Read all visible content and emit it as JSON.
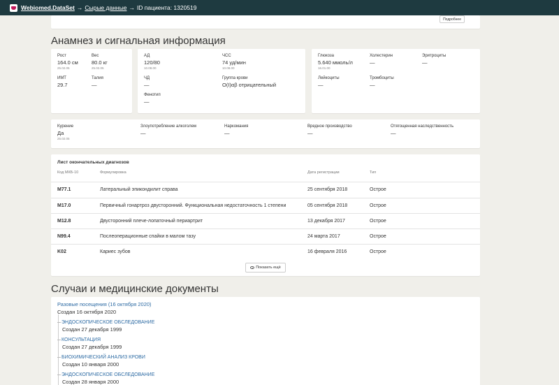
{
  "header": {
    "brand": "Webiomed.DataSet",
    "arrow": "→",
    "crumb": "Сырые данные",
    "patient_id": "ID пациента: 1320519"
  },
  "top_panel": {
    "details_button": "Подробнее"
  },
  "anamnesis": {
    "title": "Анамнез и сигнальная информация",
    "body": {
      "height": {
        "label": "Рост",
        "value": "164.0 см",
        "date": "25.02.05"
      },
      "weight": {
        "label": "Вес",
        "value": "80.0 кг",
        "date": "25.02.05"
      },
      "bmi": {
        "label": "ИМТ",
        "value": "29.7"
      },
      "waist": {
        "label": "Талия",
        "value": "—"
      }
    },
    "vitals": {
      "bp": {
        "label": "АД",
        "value": "120/80",
        "date": "10.08.00"
      },
      "hr": {
        "label": "ЧСС",
        "value": "74 уд/мин",
        "date": "10.08.00"
      },
      "rr": {
        "label": "ЧД",
        "value": "—"
      },
      "blood": {
        "label": "Группа крови",
        "value": "O(I)αβ отрицательный"
      },
      "phenotype": {
        "label": "Фенотип",
        "value": "—"
      }
    },
    "labs": {
      "glucose": {
        "label": "Глюкоза",
        "value": "5.640 ммоль/л",
        "date": "16.01.00"
      },
      "cholesterol": {
        "label": "Холестерин",
        "value": "—"
      },
      "erythrocytes": {
        "label": "Эритроциты",
        "value": "—"
      },
      "leukocytes": {
        "label": "Лейкоциты",
        "value": "—"
      },
      "platelets": {
        "label": "Тромбоциты",
        "value": "—"
      }
    },
    "habits": {
      "smoking": {
        "label": "Курение",
        "value": "Да",
        "date": "25.02.05"
      },
      "alcohol": {
        "label": "Злоупотребление алкоголем",
        "value": "—"
      },
      "drugs": {
        "label": "Наркомания",
        "value": "—"
      },
      "hazard": {
        "label": "Вредное производство",
        "value": "—"
      },
      "heredity": {
        "label": "Отягощенная наследственность",
        "value": "—"
      }
    }
  },
  "diagnoses": {
    "title": "Лист окончательных диагнозов",
    "columns": {
      "code": "Код МКБ-10",
      "name": "Формулировка",
      "date": "Дата регистрации",
      "type": "Тип"
    },
    "rows": [
      {
        "code": "M77.1",
        "name": "Латеральный эпикондилит справа",
        "date": "25 сентября 2018",
        "type": "Острое"
      },
      {
        "code": "M17.0",
        "name": "Первичный гонартроз двусторонний. Функциональная недостаточность 1 степени",
        "date": "05 сентября 2018",
        "type": "Острое"
      },
      {
        "code": "M12.8",
        "name": "Двусторонний плече-лопаточный периартрит",
        "date": "13 декабря 2017",
        "type": "Острое"
      },
      {
        "code": "N99.4",
        "name": "Послеоперационные спайки в малом тазу",
        "date": "24 марта 2017",
        "type": "Острое"
      },
      {
        "code": "K02",
        "name": "Кариес зубов",
        "date": "16 февраля 2016",
        "type": "Острое"
      }
    ],
    "show_more": "Показать ещё"
  },
  "cases": {
    "title": "Случаи и медицинские документы",
    "visit_link": "Разовые посещения (16 октября 2020)",
    "visit_created": "Создан 16 октября 2020",
    "documents": [
      {
        "title": "ЭНДОСКОПИЧЕСКОЕ ОБСЛЕДОВАНИЕ",
        "created": "Создан 27 декабря 1999"
      },
      {
        "title": "КОНСУЛЬТАЦИЯ",
        "created": "Создан 27 декабря 1999"
      },
      {
        "title": "БИОХИМИЧЕСКИЙ АНАЛИЗ КРОВИ",
        "created": "Создан 10 января 2000"
      },
      {
        "title": "ЭНДОСКОПИЧЕСКОЕ ОБСЛЕДОВАНИЕ",
        "created": "Создан 28 января 2000"
      }
    ]
  }
}
